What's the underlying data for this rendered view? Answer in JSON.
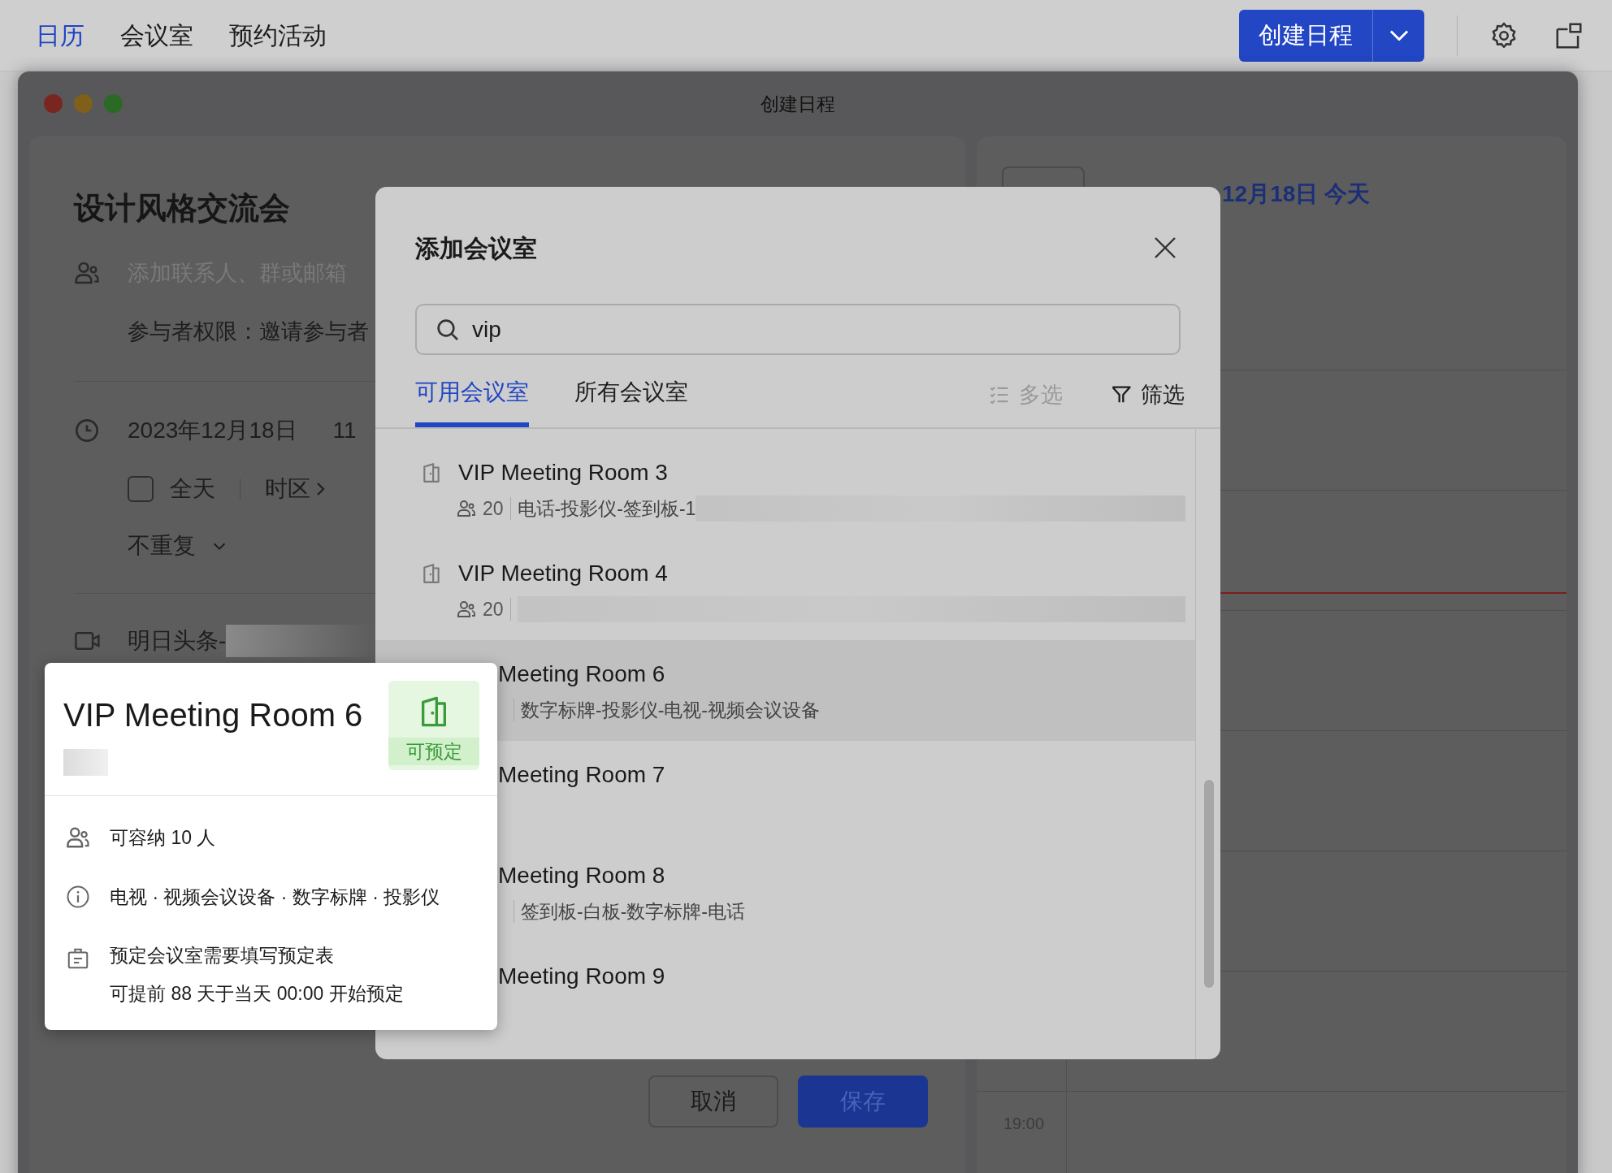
{
  "top_nav": {
    "tabs": [
      {
        "label": "日历",
        "selected": true
      },
      {
        "label": "会议室",
        "selected": false
      },
      {
        "label": "预约活动",
        "selected": false
      }
    ],
    "create_button": "创建日程"
  },
  "window": {
    "title": "创建日程"
  },
  "event_form": {
    "title": "设计风格交流会",
    "guests_placeholder": "添加联系人、群或邮箱",
    "permission": "参与者权限：邀请参与者",
    "date": "2023年12月18日",
    "time": "11",
    "all_day": {
      "label": "全天",
      "checked": false
    },
    "timezone": "时区",
    "repeat": "不重复",
    "video": "明日头条-",
    "cancel": "取消",
    "save": "保存"
  },
  "calendar": {
    "date_label": "12月18日 今天",
    "time_label": "19:00"
  },
  "dialog": {
    "title": "添加会议室",
    "search": {
      "value": "vip"
    },
    "tabs": [
      {
        "label": "可用会议室",
        "selected": true
      },
      {
        "label": "所有会议室",
        "selected": false
      }
    ],
    "multi_select": {
      "label": "多选",
      "disabled": true
    },
    "filter": "筛选",
    "rooms": [
      {
        "name": "VIP Meeting Room 3",
        "covered": false,
        "hovered": false,
        "capacity": "20",
        "facilities": "电话-投影仪-签到板-1",
        "redacted": true
      },
      {
        "name": "VIP Meeting Room 4",
        "covered": false,
        "hovered": false,
        "capacity": "20",
        "redacted": true
      },
      {
        "name": "Meeting Room 6",
        "covered": true,
        "hovered": true,
        "facilities": "数字标牌-投影仪-电视-视频会议设备"
      },
      {
        "name": "Meeting Room 7",
        "covered": true,
        "hovered": false
      },
      {
        "name": "Meeting Room 8",
        "covered": true,
        "hovered": false,
        "facilities": "签到板-白板-数字标牌-电话"
      },
      {
        "name": "Meeting Room 9",
        "covered": true,
        "hovered": false
      }
    ]
  },
  "room_card": {
    "name": "VIP Meeting Room 6",
    "status": "可预定",
    "capacity": "可容纳 10 人",
    "facilities": "电视 · 视频会议设备 · 数字标牌 · 投影仪",
    "notes": [
      "预定会议室需要填写预定表",
      "可提前 88 天于当天 00:00 开始预定"
    ]
  }
}
